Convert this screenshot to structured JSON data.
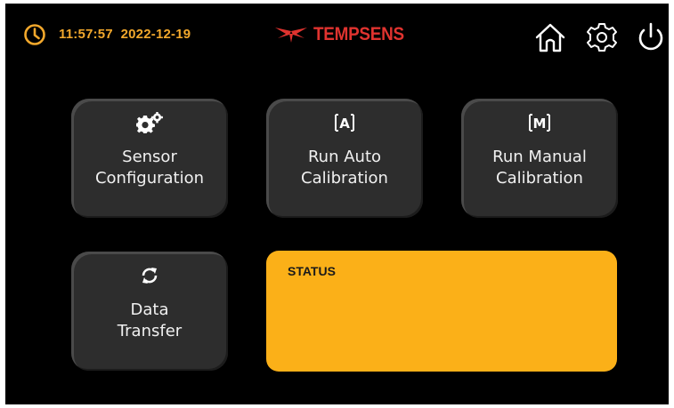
{
  "header": {
    "time": "11:57:57",
    "date": "2022-12-19",
    "brand": "TEMPSENS",
    "icons": [
      "clock-icon",
      "home-icon",
      "settings-gear-icon",
      "power-icon"
    ]
  },
  "tiles": [
    {
      "icon": "gears-icon",
      "label": "Sensor\nConfiguration"
    },
    {
      "icon": "auto-A-icon",
      "label": "Run Auto\nCalibration"
    },
    {
      "icon": "manual-M-icon",
      "label": "Run Manual\nCalibration"
    },
    {
      "icon": "sync-icon",
      "label": "Data\nTransfer"
    }
  ],
  "status": {
    "title": "STATUS",
    "message": ""
  },
  "colors": {
    "background": "#000000",
    "accent": "#f2a82c",
    "brand": "#e0332f",
    "tile": "#2d2d2d",
    "status_panel": "#fbb018"
  }
}
